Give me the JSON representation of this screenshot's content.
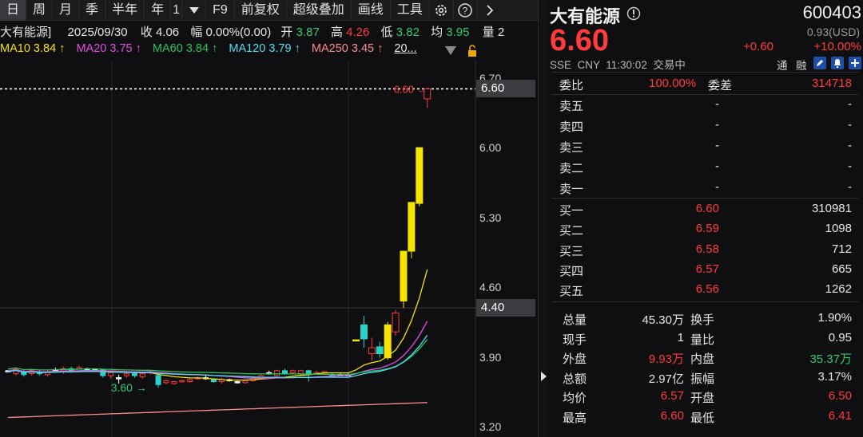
{
  "toolbar": {
    "tabs": [
      "日",
      "周",
      "月",
      "季",
      "半年",
      "年"
    ],
    "active_tab": "日",
    "extra_tab": "1",
    "items": [
      "F9",
      "前复权",
      "超级叠加",
      "画线",
      "工具"
    ]
  },
  "info": {
    "name": "大有能源]",
    "date": "2025/09/30",
    "close_label": "收",
    "close": "4.06",
    "chg_label": "幅",
    "chg": "0.00%(0.00)",
    "open_label": "开",
    "open": "3.87",
    "high_label": "高",
    "high": "4.26",
    "low_label": "低",
    "low": "3.82",
    "avg_label": "均",
    "avg": "3.95",
    "vol_label": "量",
    "vol_tail": "2"
  },
  "ma": {
    "ma10": "MA10 3.84 ↑",
    "ma20": "MA20 3.75 ↑",
    "ma60": "MA60 3.84 ↑",
    "ma120": "MA120 3.79 ↑",
    "ma250": "MA250 3.45 ↑",
    "more": "20..."
  },
  "chart_data": {
    "type": "candlestick",
    "y_ticks": [
      "6.70",
      "6.00",
      "5.30",
      "4.60",
      "3.90",
      "3.20"
    ],
    "ylim": [
      3.2,
      6.7
    ],
    "last_price_tag": "6.60",
    "cursor_price_tag": "4.40",
    "last_price_label": "6.60 →",
    "low_marker_label": "3.60 →",
    "candles": [
      {
        "o": 3.77,
        "c": 3.77,
        "h": 3.77,
        "l": 3.77
      },
      {
        "o": 3.74,
        "c": 3.79,
        "h": 3.81,
        "l": 3.72
      },
      {
        "o": 3.76,
        "c": 3.73,
        "h": 3.78,
        "l": 3.71
      },
      {
        "o": 3.74,
        "c": 3.77,
        "h": 3.79,
        "l": 3.72
      },
      {
        "o": 3.76,
        "c": 3.74,
        "h": 3.78,
        "l": 3.72
      },
      {
        "o": 3.73,
        "c": 3.76,
        "h": 3.78,
        "l": 3.71
      },
      {
        "o": 3.78,
        "c": 3.78,
        "h": 3.8,
        "l": 3.76
      },
      {
        "o": 3.76,
        "c": 3.79,
        "h": 3.81,
        "l": 3.74
      },
      {
        "o": 3.79,
        "c": 3.76,
        "h": 3.81,
        "l": 3.75
      },
      {
        "o": 3.76,
        "c": 3.8,
        "h": 3.82,
        "l": 3.75
      },
      {
        "o": 3.79,
        "c": 3.79,
        "h": 3.8,
        "l": 3.78
      },
      {
        "o": 3.78,
        "c": 3.78,
        "h": 3.79,
        "l": 3.77
      },
      {
        "o": 3.78,
        "c": 3.72,
        "h": 3.79,
        "l": 3.7
      },
      {
        "o": 3.72,
        "c": 3.75,
        "h": 3.76,
        "l": 3.69
      },
      {
        "o": 3.7,
        "c": 3.7,
        "h": 3.73,
        "l": 3.64
      },
      {
        "o": 3.72,
        "c": 3.74,
        "h": 3.76,
        "l": 3.7
      },
      {
        "o": 3.74,
        "c": 3.72,
        "h": 3.76,
        "l": 3.7
      },
      {
        "o": 3.71,
        "c": 3.74,
        "h": 3.75,
        "l": 3.69
      },
      {
        "o": 3.75,
        "c": 3.76,
        "h": 3.77,
        "l": 3.73
      },
      {
        "o": 3.72,
        "c": 3.63,
        "h": 3.73,
        "l": 3.6
      },
      {
        "o": 3.65,
        "c": 3.67,
        "h": 3.68,
        "l": 3.63
      },
      {
        "o": 3.64,
        "c": 3.66,
        "h": 3.67,
        "l": 3.63
      },
      {
        "o": 3.66,
        "c": 3.67,
        "h": 3.68,
        "l": 3.65
      },
      {
        "o": 3.66,
        "c": 3.68,
        "h": 3.69,
        "l": 3.65
      },
      {
        "o": 3.69,
        "c": 3.7,
        "h": 3.71,
        "l": 3.68
      },
      {
        "o": 3.7,
        "c": 3.7,
        "h": 3.72,
        "l": 3.68
      },
      {
        "o": 3.68,
        "c": 3.66,
        "h": 3.69,
        "l": 3.65
      },
      {
        "o": 3.66,
        "c": 3.68,
        "h": 3.7,
        "l": 3.64
      },
      {
        "o": 3.68,
        "c": 3.68,
        "h": 3.69,
        "l": 3.66
      },
      {
        "o": 3.66,
        "c": 3.66,
        "h": 3.67,
        "l": 3.64
      },
      {
        "o": 3.65,
        "c": 3.67,
        "h": 3.68,
        "l": 3.64
      },
      {
        "o": 3.67,
        "c": 3.7,
        "h": 3.71,
        "l": 3.66
      },
      {
        "o": 3.7,
        "c": 3.72,
        "h": 3.74,
        "l": 3.69
      },
      {
        "o": 3.75,
        "c": 3.75,
        "h": 3.77,
        "l": 3.73
      },
      {
        "o": 3.72,
        "c": 3.77,
        "h": 3.78,
        "l": 3.71
      },
      {
        "o": 3.77,
        "c": 3.74,
        "h": 3.79,
        "l": 3.73
      },
      {
        "o": 3.75,
        "c": 3.77,
        "h": 3.78,
        "l": 3.73
      },
      {
        "o": 3.74,
        "c": 3.77,
        "h": 3.78,
        "l": 3.73
      },
      {
        "o": 3.77,
        "c": 3.74,
        "h": 3.78,
        "l": 3.66
      },
      {
        "o": 3.74,
        "c": 3.75,
        "h": 3.77,
        "l": 3.73
      },
      {
        "o": 3.75,
        "c": 3.76,
        "h": 3.77,
        "l": 3.74
      },
      {
        "o": 3.73,
        "c": 3.71,
        "h": 3.75,
        "l": 3.7
      },
      {
        "o": 3.73,
        "c": 3.73,
        "h": 3.75,
        "l": 3.72
      },
      {
        "o": 3.73,
        "c": 3.73,
        "h": 3.74,
        "l": 3.72
      },
      {
        "o": 4.08,
        "c": 4.08,
        "h": 4.08,
        "l": 4.08
      },
      {
        "o": 4.09,
        "c": 4.23,
        "h": 4.32,
        "l": 4.0
      },
      {
        "o": 3.94,
        "c": 4.0,
        "h": 4.1,
        "l": 3.87
      },
      {
        "o": 4.01,
        "c": 3.94,
        "h": 4.06,
        "l": 3.9
      },
      {
        "o": 3.9,
        "c": 4.23,
        "h": 4.26,
        "l": 3.88
      },
      {
        "o": 4.16,
        "c": 4.35,
        "h": 4.38,
        "l": 4.12
      },
      {
        "o": 4.47,
        "c": 4.97,
        "h": 4.97,
        "l": 4.4
      },
      {
        "o": 4.97,
        "c": 5.46,
        "h": 5.46,
        "l": 4.9
      },
      {
        "o": 5.45,
        "c": 6.01,
        "h": 6.01,
        "l": 5.42
      },
      {
        "o": 6.5,
        "c": 6.6,
        "h": 6.6,
        "l": 6.41
      }
    ]
  },
  "quote": {
    "name": "大有能源",
    "code": "600403",
    "price": "6.60",
    "usd": "0.93(USD)",
    "change": "+0.60",
    "change_pct": "+10.00%",
    "meta": "SSE  CNY  11:30:02  交易中",
    "tong": "通",
    "rong": "融"
  },
  "order_book": {
    "weibi_label": "委比",
    "weibi": "100.00%",
    "weicha_label": "委差",
    "weicha": "314718",
    "sells": [
      {
        "label": "卖五",
        "price": "-",
        "vol": "-"
      },
      {
        "label": "卖四",
        "price": "-",
        "vol": "-"
      },
      {
        "label": "卖三",
        "price": "-",
        "vol": "-"
      },
      {
        "label": "卖二",
        "price": "-",
        "vol": "-"
      },
      {
        "label": "卖一",
        "price": "-",
        "vol": "-"
      }
    ],
    "buys": [
      {
        "label": "买一",
        "price": "6.60",
        "vol": "310981"
      },
      {
        "label": "买二",
        "price": "6.59",
        "vol": "1098"
      },
      {
        "label": "买三",
        "price": "6.58",
        "vol": "712"
      },
      {
        "label": "买四",
        "price": "6.57",
        "vol": "665"
      },
      {
        "label": "买五",
        "price": "6.56",
        "vol": "1262"
      }
    ]
  },
  "stats": [
    {
      "l1": "总量",
      "v1": "45.30万",
      "c1": "w",
      "l2": "换手",
      "v2": "1.90%",
      "c2": "w"
    },
    {
      "l1": "现手",
      "v1": "1",
      "c1": "w",
      "l2": "量比",
      "v2": "0.95",
      "c2": "w"
    },
    {
      "l1": "外盘",
      "v1": "9.93万",
      "c1": "r",
      "l2": "内盘",
      "v2": "35.37万",
      "c2": "g"
    },
    {
      "l1": "总额",
      "v1": "2.97亿",
      "c1": "w",
      "l2": "振幅",
      "v2": "3.17%",
      "c2": "w"
    },
    {
      "l1": "均价",
      "v1": "6.57",
      "c1": "r",
      "l2": "开盘",
      "v2": "6.50",
      "c2": "r"
    },
    {
      "l1": "最高",
      "v1": "6.60",
      "c1": "r",
      "l2": "最低",
      "v2": "6.41",
      "c2": "r"
    }
  ],
  "colors": {
    "up": "#ff3b3b",
    "down": "#2ecc71",
    "bg": "#0f0f11"
  }
}
